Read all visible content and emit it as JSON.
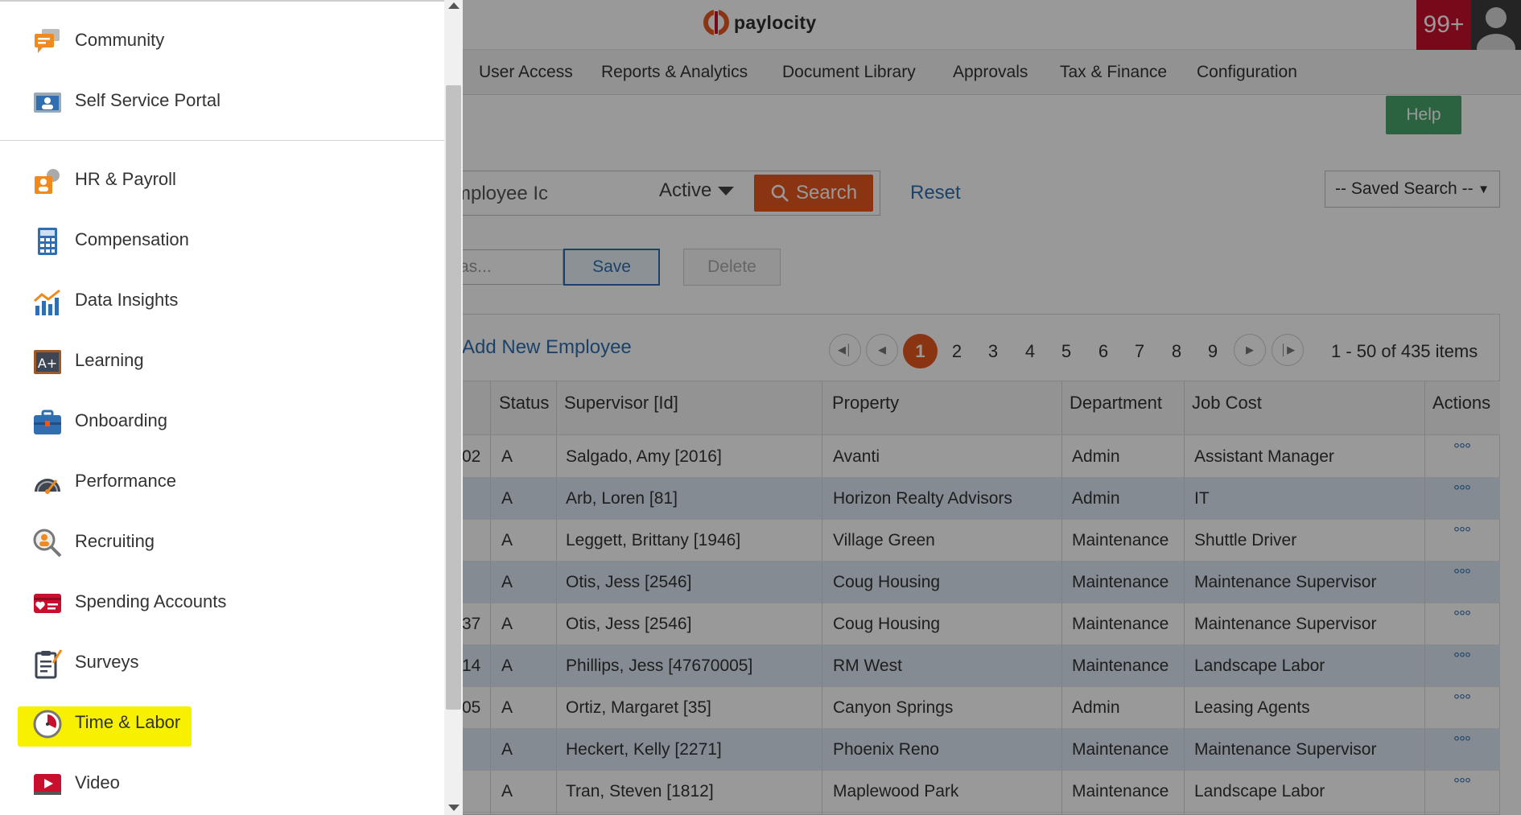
{
  "brand": {
    "name": "paylocity",
    "color": "#e8571d"
  },
  "header": {
    "notifications": "99+"
  },
  "nav": [
    "User Access",
    "Reports & Analytics",
    "Document Library",
    "Approvals",
    "Tax & Finance",
    "Configuration"
  ],
  "help_label": "Help",
  "search": {
    "value": "mployee Ic",
    "status": "Active",
    "button": "Search",
    "reset": "Reset",
    "saved_search": "-- Saved Search --",
    "save_as_placeholder": "as...",
    "save": "Save",
    "delete": "Delete"
  },
  "grid": {
    "add_employee": "Add New Employee",
    "pages": [
      "1",
      "2",
      "3",
      "4",
      "5",
      "6",
      "7",
      "8",
      "9"
    ],
    "current_page": "1",
    "page_info": "1 - 50 of 435 items",
    "headers": [
      "Status",
      "Supervisor [Id]",
      "Property",
      "Department",
      "Job Cost",
      "Actions"
    ],
    "rows": [
      {
        "id": "02",
        "status": "A",
        "supervisor": "Salgado, Amy [2016]",
        "property": "Avanti",
        "department": "Admin",
        "job": "Assistant Manager"
      },
      {
        "id": "",
        "status": "A",
        "supervisor": "Arb, Loren [81]",
        "property": "Horizon Realty Advisors",
        "department": "Admin",
        "job": "IT"
      },
      {
        "id": "",
        "status": "A",
        "supervisor": "Leggett, Brittany [1946]",
        "property": "Village Green",
        "department": "Maintenance",
        "job": "Shuttle Driver"
      },
      {
        "id": "",
        "status": "A",
        "supervisor": "Otis, Jess [2546]",
        "property": "Coug Housing",
        "department": "Maintenance",
        "job": "Maintenance Supervisor"
      },
      {
        "id": "37",
        "status": "A",
        "supervisor": "Otis, Jess [2546]",
        "property": "Coug Housing",
        "department": "Maintenance",
        "job": "Maintenance Supervisor"
      },
      {
        "id": "14",
        "status": "A",
        "supervisor": "Phillips, Jess [47670005]",
        "property": "RM West",
        "department": "Maintenance",
        "job": "Landscape Labor"
      },
      {
        "id": "05",
        "status": "A",
        "supervisor": "Ortiz, Margaret [35]",
        "property": "Canyon Springs",
        "department": "Admin",
        "job": "Leasing Agents"
      },
      {
        "id": "",
        "status": "A",
        "supervisor": "Heckert, Kelly [2271]",
        "property": "Phoenix Reno",
        "department": "Maintenance",
        "job": "Maintenance Supervisor"
      },
      {
        "id": "",
        "status": "A",
        "supervisor": "Tran, Steven [1812]",
        "property": "Maplewood Park",
        "department": "Maintenance",
        "job": "Landscape Labor"
      }
    ],
    "actions_glyph": "°°°"
  },
  "drawer": {
    "items": [
      {
        "label": "Community",
        "icon": "community-icon"
      },
      {
        "label": "Self Service Portal",
        "icon": "self-service-portal-icon"
      },
      {
        "label": "HR & Payroll",
        "icon": "hr-payroll-icon"
      },
      {
        "label": "Compensation",
        "icon": "compensation-icon"
      },
      {
        "label": "Data Insights",
        "icon": "data-insights-icon"
      },
      {
        "label": "Learning",
        "icon": "learning-icon"
      },
      {
        "label": "Onboarding",
        "icon": "onboarding-icon"
      },
      {
        "label": "Performance",
        "icon": "performance-icon"
      },
      {
        "label": "Recruiting",
        "icon": "recruiting-icon"
      },
      {
        "label": "Spending Accounts",
        "icon": "spending-accounts-icon"
      },
      {
        "label": "Surveys",
        "icon": "surveys-icon"
      },
      {
        "label": "Time & Labor",
        "icon": "time-labor-icon"
      },
      {
        "label": "Video",
        "icon": "video-icon"
      }
    ],
    "highlighted": "Time & Labor",
    "highlight_color": "#f7f100"
  },
  "colors": {
    "accent": "#e8571d",
    "link": "#2f6fb1",
    "help": "#48a56b",
    "notification": "#c8102e",
    "row_alt": "#dde8f5"
  }
}
